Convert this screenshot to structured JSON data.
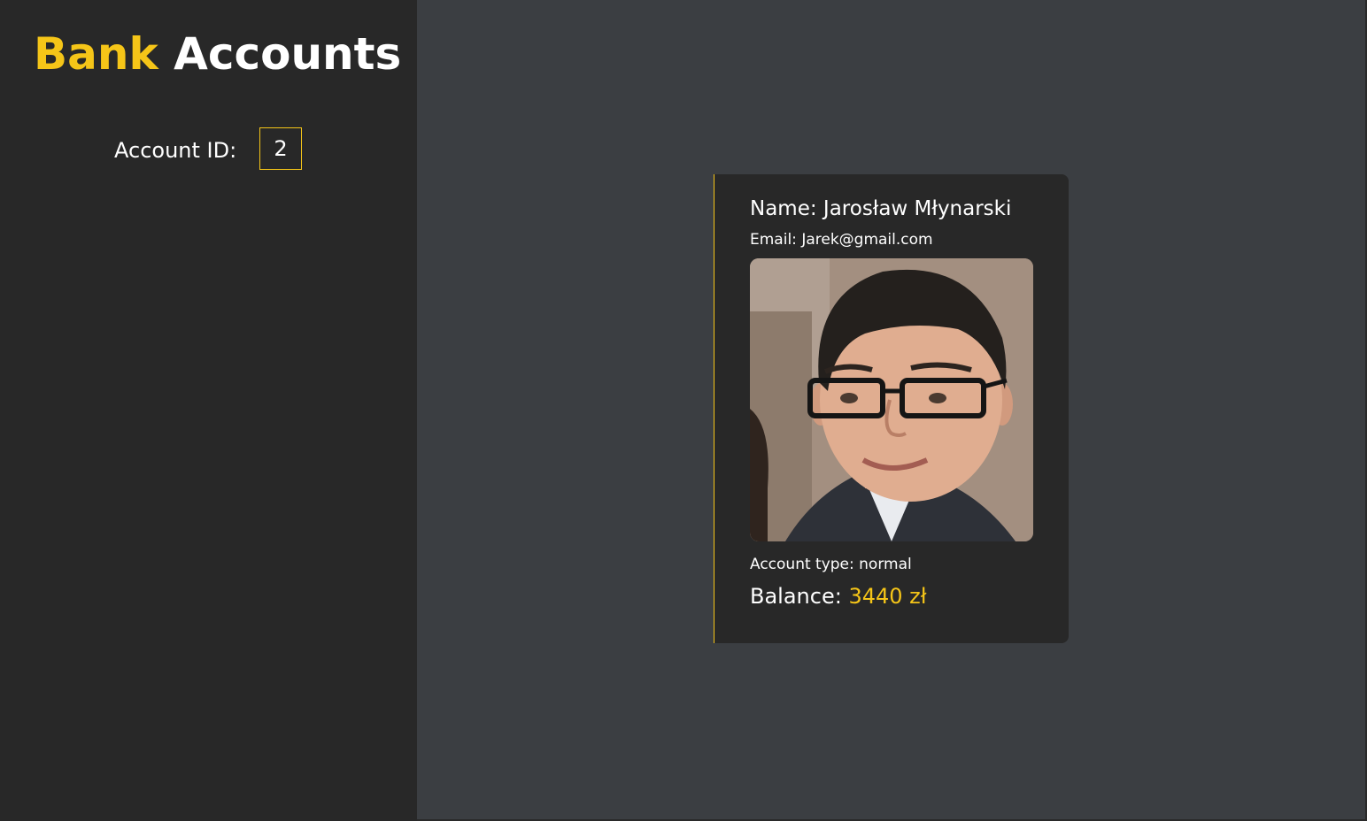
{
  "sidebar": {
    "title_accent": "Bank",
    "title_main": "Accounts",
    "account_id_label": "Account ID:",
    "account_id_value": "2"
  },
  "account": {
    "name_label": "Name:",
    "name": "Jarosław Młynarski",
    "email_label": "Email:",
    "email": "Jarek@gmail.com",
    "type_label": "Account type:",
    "type": "normal",
    "balance_label": "Balance:",
    "balance": "3440 zł"
  },
  "colors": {
    "accent": "#f5c518",
    "sidebar_bg": "#282828",
    "main_bg": "#3b3e42",
    "card_bg": "#282828",
    "text": "#ffffff"
  }
}
